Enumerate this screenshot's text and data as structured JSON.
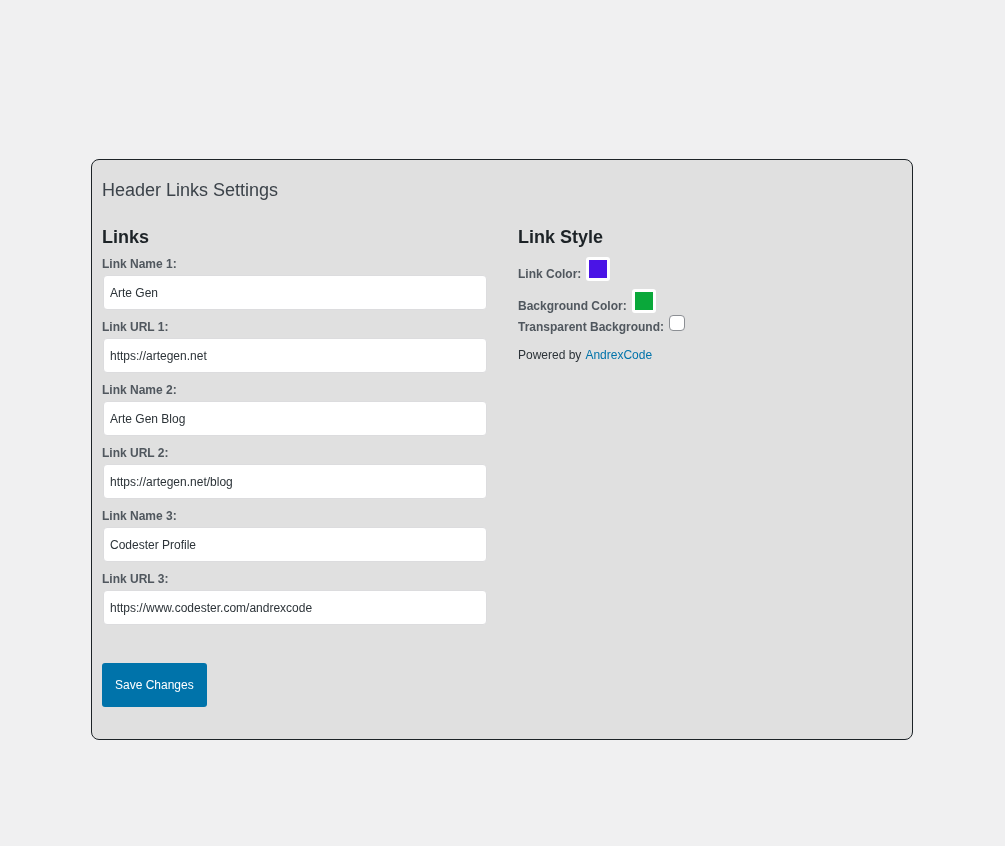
{
  "panel": {
    "title": "Header Links Settings"
  },
  "links": {
    "heading": "Links",
    "fields": [
      {
        "label": "Link Name 1:",
        "value": "Arte Gen"
      },
      {
        "label": "Link URL 1:",
        "value": "https://artegen.net"
      },
      {
        "label": "Link Name 2:",
        "value": "Arte Gen Blog"
      },
      {
        "label": "Link URL 2:",
        "value": "https://artegen.net/blog"
      },
      {
        "label": "Link Name 3:",
        "value": "Codester Profile"
      },
      {
        "label": "Link URL 3:",
        "value": "https://www.codester.com/andrexcode"
      }
    ]
  },
  "style": {
    "heading": "Link Style",
    "options": [
      {
        "kind": "color",
        "label": "Link Color:",
        "color": "#4a14e6"
      },
      {
        "kind": "color",
        "label": "Background Color:",
        "color": "#0aa83a"
      },
      {
        "kind": "checkbox",
        "label": "Transparent Background:",
        "checked": false
      }
    ],
    "credit": {
      "text": "Powered by",
      "link": "AndrexCode"
    }
  },
  "save_button": "Save Changes"
}
